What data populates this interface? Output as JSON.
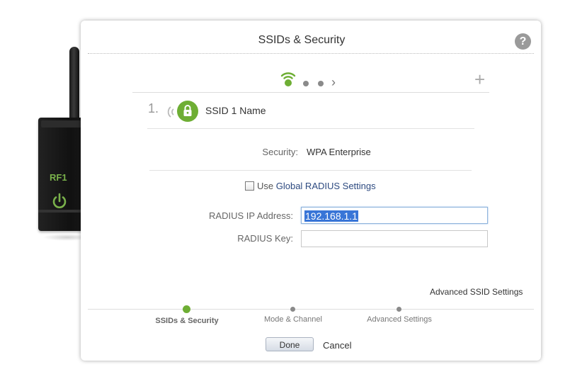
{
  "device": {
    "rf_label": "RF1"
  },
  "dialog": {
    "title": "SSIDs & Security",
    "help_icon": "?",
    "plus_icon": "+",
    "chevron_icon": "›"
  },
  "ssid": {
    "index": "1.",
    "name": "SSID 1 Name"
  },
  "security": {
    "label": "Security:",
    "value": "WPA Enterprise"
  },
  "global_radius": {
    "checked": false,
    "prefix": "Use ",
    "link": "Global RADIUS Settings"
  },
  "radius": {
    "ip_label": "RADIUS IP Address:",
    "ip_value": "192.168.1.1",
    "key_label": "RADIUS Key:",
    "key_value": ""
  },
  "advanced_link": "Advanced SSID Settings",
  "steps": [
    {
      "label": "SSIDs & Security",
      "active": true
    },
    {
      "label": "Mode & Channel",
      "active": false
    },
    {
      "label": "Advanced Settings",
      "active": false
    }
  ],
  "buttons": {
    "done": "Done",
    "cancel": "Cancel"
  },
  "colors": {
    "accent_green": "#6eae34",
    "link_blue": "#2d4a80",
    "selection_blue": "#3875d7"
  }
}
